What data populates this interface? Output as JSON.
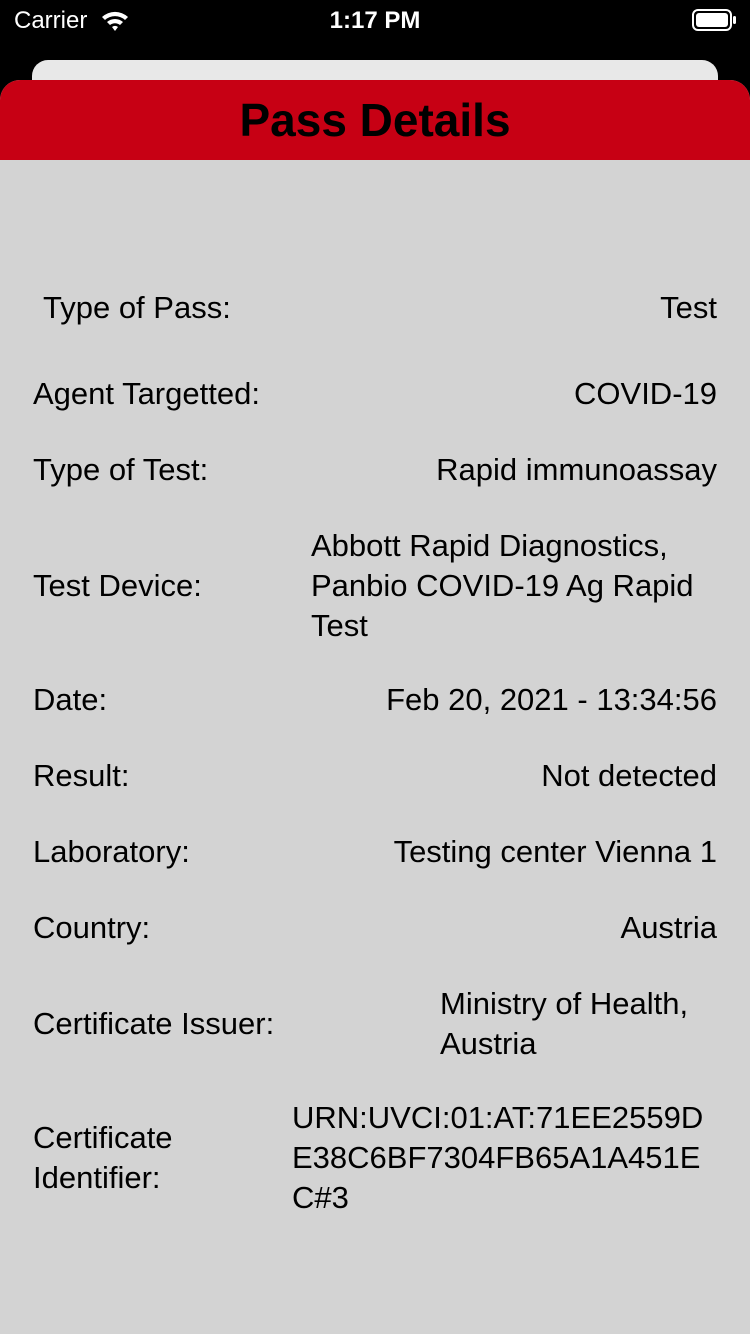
{
  "status_bar": {
    "carrier": "Carrier",
    "time": "1:17 PM",
    "wifi_icon": "wifi-icon",
    "battery_icon": "battery-full-icon"
  },
  "header": {
    "title": "Pass Details",
    "background_color": "#c70014"
  },
  "details": [
    {
      "label": "Type of Pass:",
      "value": "Test"
    },
    {
      "label": "Agent Targetted:",
      "value": "COVID-19"
    },
    {
      "label": "Type of Test:",
      "value": "Rapid immunoassay"
    },
    {
      "label": "Test Device:",
      "value_lines": [
        "Abbott Rapid Diagnostics,",
        "Panbio COVID-19 Ag Rapid",
        "Test"
      ]
    },
    {
      "label": "Date:",
      "value": "Feb 20, 2021 - 13:34:56"
    },
    {
      "label": "Result:",
      "value": "Not detected"
    },
    {
      "label": "Laboratory:",
      "value": "Testing center Vienna 1"
    },
    {
      "label": "Country:",
      "value": "Austria"
    },
    {
      "label": "Certificate Issuer:",
      "value_lines": [
        "Ministry of Health,",
        "Austria"
      ]
    },
    {
      "label_lines": [
        "Certificate",
        "Identifier:"
      ],
      "value_lines": [
        "URN:UVCI:01:AT:71EE2559D",
        "E38C6BF7304FB65A1A451E",
        "C#3"
      ]
    }
  ]
}
